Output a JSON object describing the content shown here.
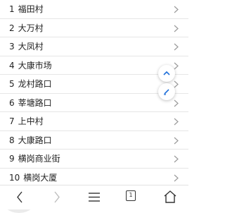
{
  "list": {
    "items": [
      {
        "index": "1",
        "name": "福田村"
      },
      {
        "index": "2",
        "name": "大万村"
      },
      {
        "index": "3",
        "name": "大凤村"
      },
      {
        "index": "4",
        "name": "大康市场"
      },
      {
        "index": "5",
        "name": "龙村路口"
      },
      {
        "index": "6",
        "name": "莘塘路口"
      },
      {
        "index": "7",
        "name": "上中村"
      },
      {
        "index": "8",
        "name": "大康路口"
      },
      {
        "index": "9",
        "name": "横岗商业街"
      },
      {
        "index": "10",
        "name": "横岗大厦"
      }
    ]
  },
  "floating_buttons": {
    "scroll_top_icon": "chevron-up-icon",
    "edit_icon": "pencil-icon",
    "accent_color": "#1e6fd9"
  },
  "bottom_bar": {
    "tab_count": "1",
    "back_icon": "chevron-left-icon",
    "forward_icon": "chevron-right-icon",
    "menu_icon": "hamburger-menu-icon",
    "home_icon": "home-icon"
  }
}
